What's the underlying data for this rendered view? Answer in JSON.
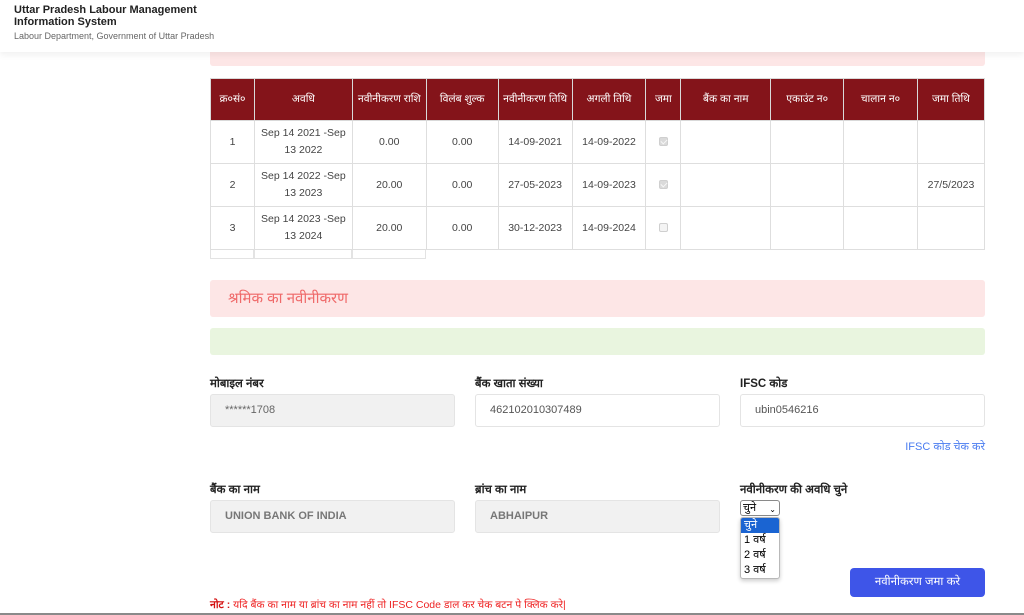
{
  "header": {
    "title_line1": "Uttar Pradesh Labour Management",
    "title_line2": "Information System",
    "subtitle": "Labour Department, Government of Uttar Pradesh"
  },
  "table": {
    "columns": [
      "क्र०सं०",
      "अवधि",
      "नवीनीकरण राशि",
      "विलंब शुल्क",
      "नवीनीकरण तिथि",
      "अगली तिथि",
      "जमा",
      "बैंक का नाम",
      "एकाउंट न०",
      "चालान न०",
      "जमा तिथि"
    ],
    "rows": [
      {
        "sno": "1",
        "period": "Sep 14 2021 -Sep 13 2022",
        "amount": "0.00",
        "late_fee": "0.00",
        "renew_date": "14-09-2021",
        "next_date": "14-09-2022",
        "deposited": true,
        "bank": "",
        "account": "",
        "challan": "",
        "deposit_date": ""
      },
      {
        "sno": "2",
        "period": "Sep 14 2022 -Sep 13 2023",
        "amount": "20.00",
        "late_fee": "0.00",
        "renew_date": "27-05-2023",
        "next_date": "14-09-2023",
        "deposited": true,
        "bank": "",
        "account": "",
        "challan": "",
        "deposit_date": "27/5/2023"
      },
      {
        "sno": "3",
        "period": "Sep 14 2023 -Sep 13 2024",
        "amount": "20.00",
        "late_fee": "0.00",
        "renew_date": "30-12-2023",
        "next_date": "14-09-2024",
        "deposited": false,
        "bank": "",
        "account": "",
        "challan": "",
        "deposit_date": ""
      }
    ]
  },
  "section": {
    "title": "श्रमिक का नवीनीकरण"
  },
  "form": {
    "mobile_label": "मोबाइल नंबर",
    "mobile_value": "******1708",
    "account_label": "बैंक खाता संख्या",
    "account_value": "462102010307489",
    "ifsc_label": "IFSC कोड",
    "ifsc_value": "ubin0546216",
    "ifsc_check_link": "IFSC कोड चेक करे",
    "bank_label": "बैंक का नाम",
    "bank_value": "UNION BANK OF INDIA",
    "branch_label": "ब्रांच का नाम",
    "branch_value": "ABHAIPUR",
    "period_label": "नवीनीकरण की अवधि चुने",
    "period_selected": "चुने",
    "period_options": [
      "चुने",
      "1 वर्ष",
      "2 वर्ष",
      "3 वर्ष"
    ],
    "submit_label": "नवीनीकरण जमा करे",
    "note_prefix": "नोट :",
    "note_text": " यदि बैंक का नाम या ब्रांच का नाम नहीं तो IFSC Code डाल कर चेक बटन पे क्लिक करे|"
  },
  "colors": {
    "table_header": "#84141a",
    "alert_bg": "#fde6e6",
    "alert_text": "#ef6a6a",
    "success_bg": "#e9f5df",
    "primary_button": "#3e55e8",
    "link": "#4a7cf0",
    "note": "#ee2222"
  }
}
